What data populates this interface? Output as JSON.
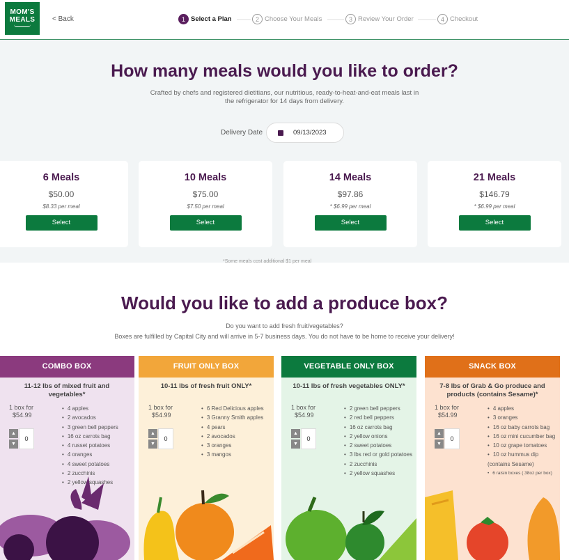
{
  "brand": {
    "line1": "MOM'S",
    "line2": "MEALS"
  },
  "nav": {
    "back_label": "< Back"
  },
  "steps": [
    {
      "num": "1",
      "label": "Select a Plan"
    },
    {
      "num": "2",
      "label": "Choose Your Meals"
    },
    {
      "num": "3",
      "label": "Review Your Order"
    },
    {
      "num": "4",
      "label": "Checkout"
    }
  ],
  "plan": {
    "title": "How many meals would you like to order?",
    "subtitle_line1": "Crafted by chefs and registered dietitians, our nutritious, ready-to-heat-and-eat meals last in",
    "subtitle_line2": "the refrigerator for 14 days from delivery.",
    "delivery_label": "Delivery Date",
    "delivery_date": "09/13/2023",
    "cards": [
      {
        "title": "6 Meals",
        "price": "$50.00",
        "per_meal": "$8.33 per meal",
        "button": "Select"
      },
      {
        "title": "10 Meals",
        "price": "$75.00",
        "per_meal": "$7.50 per meal",
        "button": "Select"
      },
      {
        "title": "14 Meals",
        "price": "$97.86",
        "per_meal": "* $6.99 per meal",
        "button": "Select"
      },
      {
        "title": "21 Meals",
        "price": "$146.79",
        "per_meal": "* $6.99 per meal",
        "button": "Select"
      }
    ],
    "footnote": "*Some meals cost additional $1 per meal"
  },
  "produce": {
    "title": "Would you like to add a produce box?",
    "line1": "Do you want to add fresh fruit/vegetables?",
    "line2": "Boxes are fulfilled by Capital City and will arrive in 5-7 business days. You do not have to be home to receive your delivery!",
    "boxes": [
      {
        "name": "COMBO BOX",
        "header_color": "#8b3a7e",
        "bg_color": "#efe2ef",
        "subtitle": "11-12 lbs of mixed fruit and vegetables*",
        "per_box": "1 box for",
        "price": "$54.99",
        "qty": "0",
        "items": [
          "4 apples",
          "2 avocados",
          "3 green bell peppers",
          "16 oz carrots bag",
          "4 russet potatoes",
          "4 oranges",
          "4 sweet potatoes",
          "2 zucchinis",
          "2 yellow squashes"
        ]
      },
      {
        "name": "FRUIT ONLY BOX",
        "header_color": "#f2a63a",
        "bg_color": "#fdf0d9",
        "subtitle": "10-11 lbs of fresh fruit ONLY*",
        "per_box": "1 box for",
        "price": "$54.99",
        "qty": "0",
        "items": [
          "6 Red Delicious apples",
          "3 Granny Smith apples",
          "4 pears",
          "2 avocados",
          "3 oranges",
          "3 mangos"
        ]
      },
      {
        "name": "VEGETABLE ONLY BOX",
        "header_color": "#0c7a3e",
        "bg_color": "#e4f4e7",
        "subtitle": "10-11 lbs of fresh vegetables ONLY*",
        "per_box": "1 box for",
        "price": "$54.99",
        "qty": "0",
        "items": [
          "2 green bell peppers",
          "2 red bell peppers",
          "16 oz carrots bag",
          "2 yellow onions",
          "2 sweet potatoes",
          "3 lbs red or gold potatoes",
          "2 zucchinis",
          "2 yellow squashes"
        ]
      },
      {
        "name": "SNACK BOX",
        "header_color": "#e07019",
        "bg_color": "#fde2d0",
        "subtitle": "7-8 lbs of Grab & Go produce and products (contains Sesame)*",
        "per_box": "1 box for",
        "price": "$54.99",
        "qty": "0",
        "items": [
          "4 apples",
          "3 oranges",
          "16 oz baby carrots bag",
          "16 oz mini cucumber bag",
          "10 oz grape tomatoes",
          "10 oz hummus dip (contains  Sesame)",
          "6 raisin boxes (.38oz per box)"
        ]
      }
    ]
  }
}
